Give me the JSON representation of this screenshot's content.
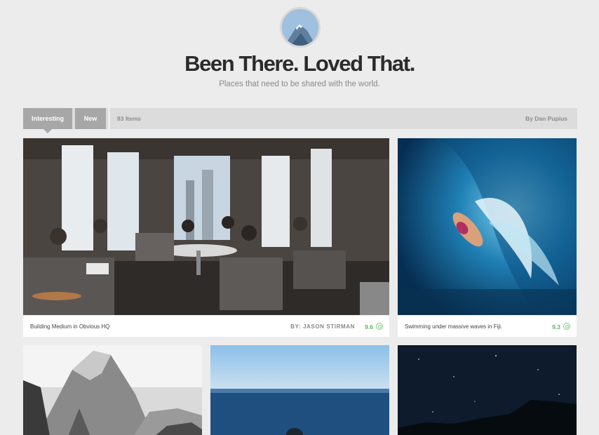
{
  "header": {
    "title": "Been There. Loved That.",
    "subtitle": "Places that need to be shared with the world."
  },
  "toolbar": {
    "tabs": [
      {
        "label": "Interesting",
        "active": true
      },
      {
        "label": "New",
        "active": false
      }
    ],
    "item_count": "83 Items",
    "byline": "By Dan Pupius"
  },
  "posts": [
    {
      "caption": "Building Medium in Obvious HQ",
      "author": "BY: JASON STIRMAN",
      "score": "9.6"
    },
    {
      "caption": "Swimming under massive waves in Fiji.",
      "author": "",
      "score": "9.3"
    },
    {
      "caption": "",
      "author": "",
      "score": ""
    },
    {
      "caption": "",
      "author": "",
      "score": ""
    },
    {
      "caption": "",
      "author": "",
      "score": ""
    }
  ],
  "colors": {
    "background": "#ececec",
    "tab_active": "#a7a7a7",
    "toolbar": "#dcdcdc",
    "score": "#5cb85c"
  },
  "icons": [
    "mountain-avatar-icon",
    "score-icon"
  ]
}
